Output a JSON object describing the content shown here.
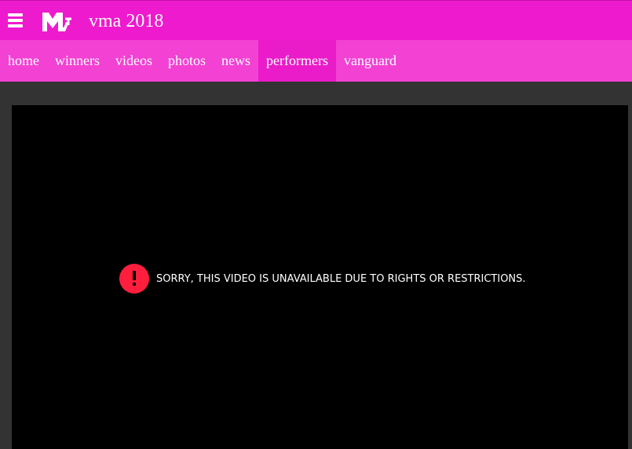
{
  "header": {
    "title": "vma 2018",
    "logo_text": "MTV",
    "menu_icon": "hamburger-menu-icon",
    "background_color": "#ee1acd"
  },
  "nav": {
    "background_color": "#f241d3",
    "active_color": "#ea1bc9",
    "items": [
      {
        "label": "home"
      },
      {
        "label": "winners"
      },
      {
        "label": "videos"
      },
      {
        "label": "photos"
      },
      {
        "label": "news"
      },
      {
        "label": "performers",
        "active": true
      },
      {
        "label": "vanguard"
      }
    ]
  },
  "player": {
    "error_message": "SORRY, THIS VIDEO IS UNAVAILABLE DUE TO RIGHTS OR RESTRICTIONS.",
    "error_icon": "exclamation-circle-icon",
    "error_color": "#ff1f3d"
  }
}
